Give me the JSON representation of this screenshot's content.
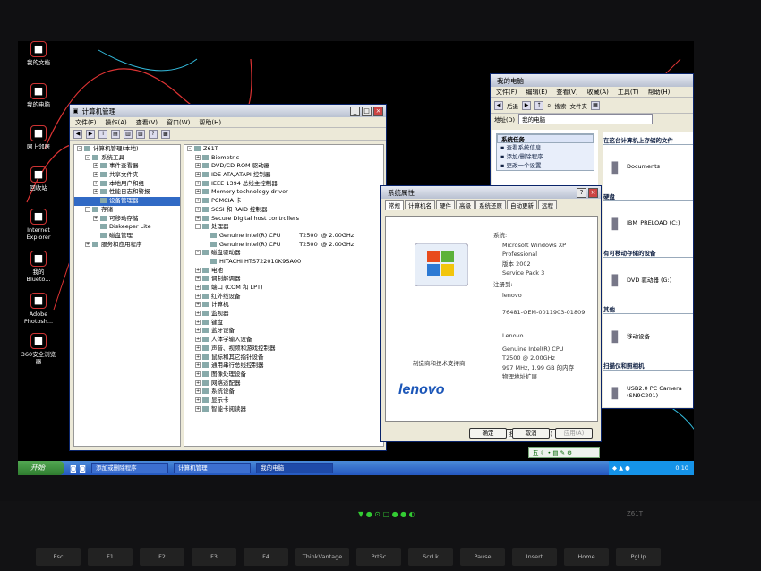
{
  "desktop_icons": [
    {
      "label": "我的文档",
      "icon": "documents-icon"
    },
    {
      "label": "我的电脑",
      "icon": "computer-icon"
    },
    {
      "label": "网上邻居",
      "icon": "network-icon"
    },
    {
      "label": "回收站",
      "icon": "recycle-bin-icon"
    },
    {
      "label": "Internet\nExplorer",
      "icon": "ie-icon"
    },
    {
      "label": "我的\nBlueto...",
      "icon": "bluetooth-icon"
    },
    {
      "label": "Adobe\nPhotosh...",
      "icon": "photoshop-icon"
    },
    {
      "label": "360安全浏览\n器",
      "icon": "browser-360-icon"
    }
  ],
  "computer_mgmt": {
    "title": "计算机管理",
    "menu": [
      "文件(F)",
      "操作(A)",
      "查看(V)",
      "窗口(W)",
      "帮助(H)"
    ],
    "left_tree": [
      {
        "label": "计算机管理(本地)",
        "level": 0,
        "exp": "-"
      },
      {
        "label": "系统工具",
        "level": 1,
        "exp": "-"
      },
      {
        "label": "事件查看器",
        "level": 2,
        "exp": "+"
      },
      {
        "label": "共享文件夹",
        "level": 2,
        "exp": "+"
      },
      {
        "label": "本地用户和组",
        "level": 2,
        "exp": "+"
      },
      {
        "label": "性能日志和警报",
        "level": 2,
        "exp": "+"
      },
      {
        "label": "设备管理器",
        "level": 2,
        "exp": "",
        "selected": true
      },
      {
        "label": "存储",
        "level": 1,
        "exp": "-"
      },
      {
        "label": "可移动存储",
        "level": 2,
        "exp": "+"
      },
      {
        "label": "Diskeeper Lite",
        "level": 2,
        "exp": ""
      },
      {
        "label": "磁盘管理",
        "level": 2,
        "exp": ""
      },
      {
        "label": "服务和应用程序",
        "level": 1,
        "exp": "+"
      }
    ],
    "right_tree": [
      {
        "label": "Z61T",
        "level": 0,
        "exp": "-"
      },
      {
        "label": "Biometric",
        "level": 1,
        "exp": "+"
      },
      {
        "label": "DVD/CD-ROM 驱动器",
        "level": 1,
        "exp": "+"
      },
      {
        "label": "IDE ATA/ATAPI 控制器",
        "level": 1,
        "exp": "+"
      },
      {
        "label": "IEEE 1394 总线主控制器",
        "level": 1,
        "exp": "+"
      },
      {
        "label": "Memory technology driver",
        "level": 1,
        "exp": "+"
      },
      {
        "label": "PCMCIA 卡",
        "level": 1,
        "exp": "+"
      },
      {
        "label": "SCSI 和 RAID 控制器",
        "level": 1,
        "exp": "+"
      },
      {
        "label": "Secure Digital host controllers",
        "level": 1,
        "exp": "+"
      },
      {
        "label": "处理器",
        "level": 1,
        "exp": "-"
      },
      {
        "label": "Genuine Intel(R) CPU          T2500  @ 2.00GHz",
        "level": 2,
        "exp": ""
      },
      {
        "label": "Genuine Intel(R) CPU          T2500  @ 2.00GHz",
        "level": 2,
        "exp": ""
      },
      {
        "label": "磁盘驱动器",
        "level": 1,
        "exp": "-"
      },
      {
        "label": "HITACHI HTS722010K9SA00",
        "level": 2,
        "exp": ""
      },
      {
        "label": "电池",
        "level": 1,
        "exp": "+"
      },
      {
        "label": "调制解调器",
        "level": 1,
        "exp": "+"
      },
      {
        "label": "端口 (COM 和 LPT)",
        "level": 1,
        "exp": "+"
      },
      {
        "label": "红外线设备",
        "level": 1,
        "exp": "+"
      },
      {
        "label": "计算机",
        "level": 1,
        "exp": "+"
      },
      {
        "label": "监视器",
        "level": 1,
        "exp": "+"
      },
      {
        "label": "键盘",
        "level": 1,
        "exp": "+"
      },
      {
        "label": "蓝牙设备",
        "level": 1,
        "exp": "+"
      },
      {
        "label": "人体学输入设备",
        "level": 1,
        "exp": "+"
      },
      {
        "label": "声音、视频和游戏控制器",
        "level": 1,
        "exp": "+"
      },
      {
        "label": "鼠标和其它指针设备",
        "level": 1,
        "exp": "+"
      },
      {
        "label": "通用串行总线控制器",
        "level": 1,
        "exp": "+"
      },
      {
        "label": "图像处理设备",
        "level": 1,
        "exp": "+"
      },
      {
        "label": "网络适配器",
        "level": 1,
        "exp": "+"
      },
      {
        "label": "系统设备",
        "level": 1,
        "exp": "+"
      },
      {
        "label": "显示卡",
        "level": 1,
        "exp": "+"
      },
      {
        "label": "智能卡阅读器",
        "level": 1,
        "exp": "+"
      }
    ]
  },
  "my_computer": {
    "title": "我的电脑",
    "menu": [
      "文件(F)",
      "编辑(E)",
      "查看(V)",
      "收藏(A)",
      "工具(T)",
      "帮助(H)"
    ],
    "back": "后退",
    "search": "搜索",
    "folders": "文件夹",
    "address_label": "地址(D)",
    "address_value": "我的电脑",
    "tasks_header": "系统任务",
    "tasks": [
      "查看系统信息",
      "添加/删除程序",
      "更改一个设置"
    ],
    "groups": [
      {
        "header": "在这台计算机上存储的文件",
        "items": [
          {
            "label": "Documents",
            "icon": "folder-icon"
          }
        ]
      },
      {
        "header": "硬盘",
        "items": [
          {
            "label": "IBM_PRELOAD (C:)",
            "icon": "hard-drive-icon"
          }
        ]
      },
      {
        "header": "有可移动存储的设备",
        "items": [
          {
            "label": "DVD 驱动器 (G:)",
            "icon": "dvd-drive-icon"
          }
        ]
      },
      {
        "header": "其他",
        "items": [
          {
            "label": "移动设备",
            "icon": "mobile-device-icon"
          }
        ]
      },
      {
        "header": "扫描仪和照相机",
        "items": [
          {
            "label": "USB2.0 PC Camera\n(SN9C201)",
            "icon": "camera-icon"
          }
        ]
      }
    ]
  },
  "sys_props": {
    "title": "系统属性",
    "tabs": [
      "常规",
      "计算机名",
      "硬件",
      "高级",
      "系统还原",
      "自动更新",
      "远程"
    ],
    "system_label": "系统:",
    "system_lines": [
      "Microsoft Windows XP",
      "Professional",
      "版本 2002",
      "Service Pack 3"
    ],
    "registered_label": "注册到:",
    "registered_to": "lenovo",
    "product_id": "76481-OEM-0011903-01809",
    "maker_label": "制造商和技术支持商:",
    "maker": "Lenovo",
    "cpu_lines": [
      "Genuine Intel(R) CPU",
      "T2500  @ 2.00GHz",
      "997 MHz, 1.99 GB 的内存",
      "物理地址扩展"
    ],
    "support_button": "技术支持信息(S)",
    "brand": "lenovo",
    "ok": "确定",
    "cancel": "取消",
    "apply": "应用(A)"
  },
  "taskbar": {
    "start": "开始",
    "buttons": [
      "添加或删除程序",
      "计算机管理",
      "我的电脑"
    ],
    "ime": "五",
    "clock": "0:10"
  },
  "laptop": {
    "model": "Z61T",
    "keys": [
      "Esc",
      "F1",
      "F2",
      "F3",
      "F4",
      "ThinkVantage",
      "PrtSc",
      "ScrLk",
      "Pause",
      "Insert",
      "Home",
      "PgUp"
    ]
  }
}
